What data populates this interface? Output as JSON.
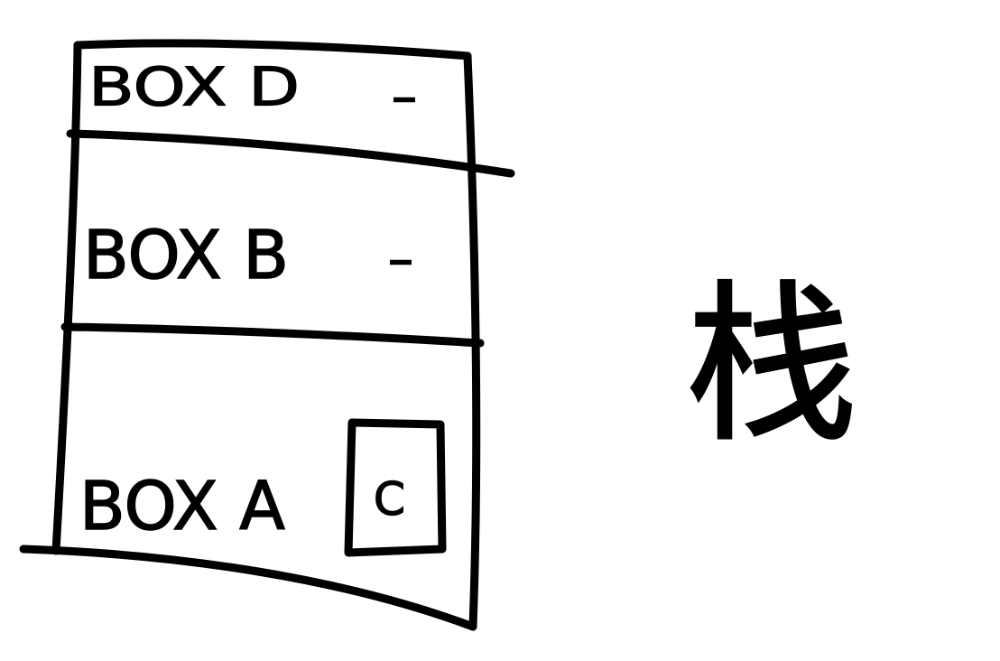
{
  "diagram": {
    "stack": {
      "boxes": [
        {
          "label": "BOX D",
          "marker": "–"
        },
        {
          "label": "BOX B",
          "marker": "–"
        },
        {
          "label": "BOX A",
          "marker": "C"
        }
      ]
    },
    "side_label": "栈"
  }
}
